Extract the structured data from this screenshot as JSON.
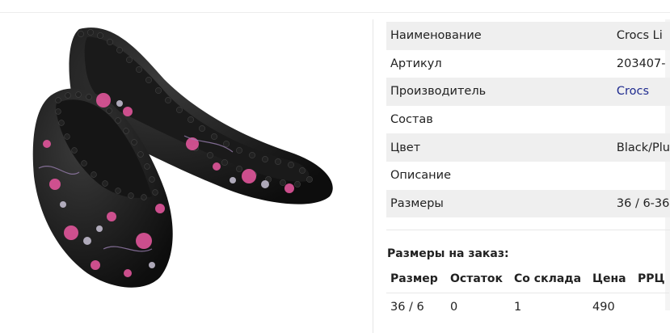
{
  "specs": [
    {
      "label": "Наименование",
      "value": "Crocs Li",
      "link": false
    },
    {
      "label": "Артикул",
      "value": "203407-",
      "link": false
    },
    {
      "label": "Производитель",
      "value": "Crocs",
      "link": true
    },
    {
      "label": "Состав",
      "value": "",
      "link": false
    },
    {
      "label": "Цвет",
      "value": "Black/Plu",
      "link": false
    },
    {
      "label": "Описание",
      "value": "",
      "link": false
    },
    {
      "label": "Размеры",
      "value": "36 / 6-36",
      "link": false
    }
  ],
  "order": {
    "title": "Размеры на заказ:",
    "headers": [
      "Размер",
      "Остаток",
      "Со склада",
      "Цена",
      "РРЦ"
    ],
    "rows": [
      [
        "36 / 6",
        "0",
        "1",
        "490",
        ""
      ]
    ]
  },
  "colors": {
    "link": "#1f2b8f",
    "stripe": "#efefef"
  },
  "image": {
    "subject": "black floral ballet flats with studded trim",
    "icon": "shoe-image"
  }
}
